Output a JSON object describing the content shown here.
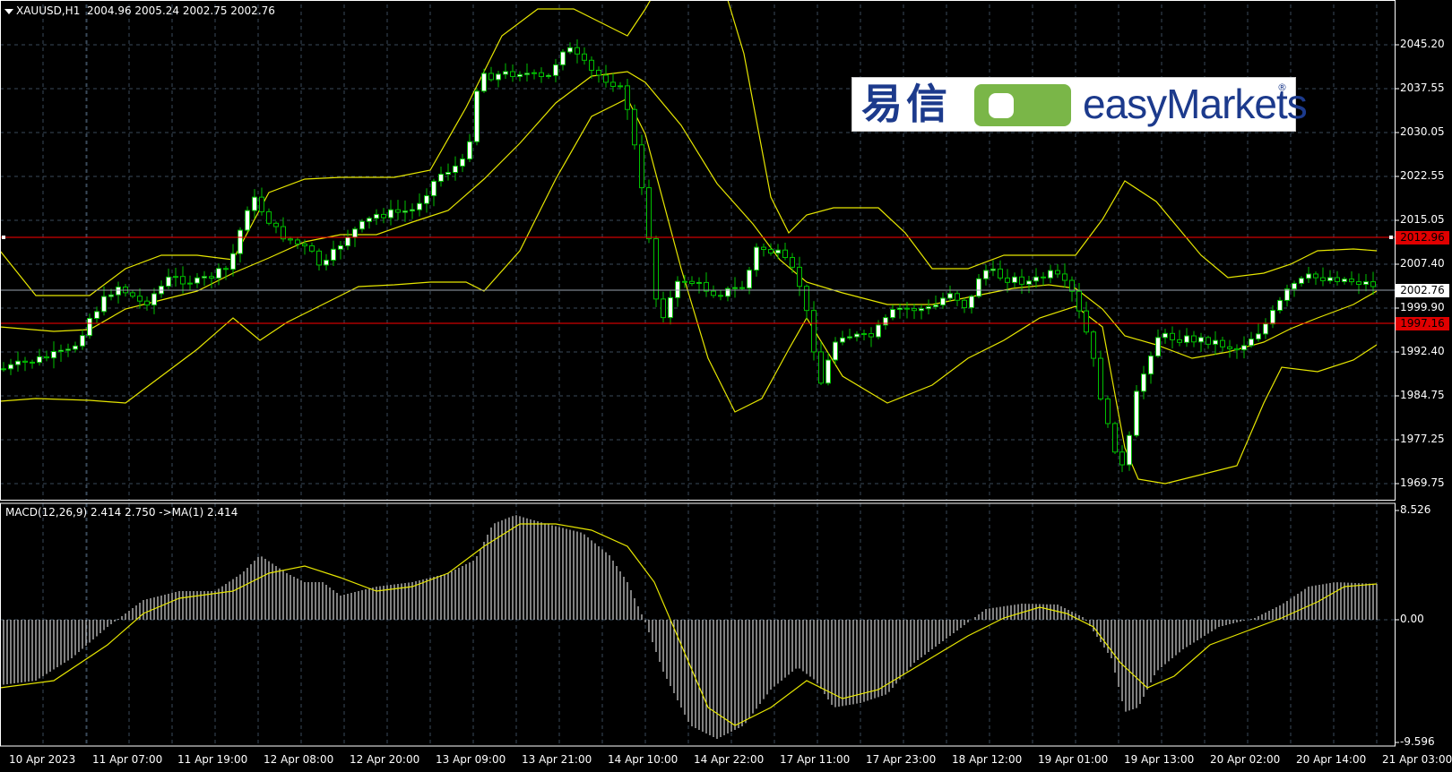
{
  "header": {
    "symbol": "XAUUSD,H1",
    "ohlc": "2004.96 2005.24 2002.75 2002.76"
  },
  "price_axis": {
    "ticks": [
      "2045.20",
      "2037.55",
      "2030.05",
      "2022.55",
      "2015.05",
      "2007.40",
      "1999.90",
      "1992.40",
      "1984.75",
      "1977.25",
      "1969.75"
    ],
    "current_price": "2002.76",
    "level_upper": "2012.96",
    "level_lower": "1997.16"
  },
  "indicator": {
    "label": "MACD(12,26,9) 2.414 2.750  ->MA(1) 2.414",
    "ticks": [
      "8.526",
      "0.00",
      "-9.596"
    ]
  },
  "time_axis": {
    "labels": [
      "10 Apr 2023",
      "11 Apr 07:00",
      "11 Apr 19:00",
      "12 Apr 08:00",
      "12 Apr 20:00",
      "13 Apr 09:00",
      "13 Apr 21:00",
      "14 Apr 10:00",
      "14 Apr 22:00",
      "17 Apr 11:00",
      "17 Apr 23:00",
      "18 Apr 12:00",
      "19 Apr 01:00",
      "19 Apr 13:00",
      "20 Apr 02:00",
      "20 Apr 14:00",
      "21 Apr 03:00"
    ]
  },
  "logo": {
    "chinese": "易信",
    "english": "easyMarkets",
    "mark": "®"
  },
  "colors": {
    "background": "#000000",
    "grid": "#3a4a5a",
    "bull_candle": "#ffffff",
    "bear_candle": "#000000",
    "wick": "#00c000",
    "bands": "#e6e600",
    "level_line": "#ff0000",
    "macd_hist": "#ffffff",
    "signal": "#e6e600"
  }
}
